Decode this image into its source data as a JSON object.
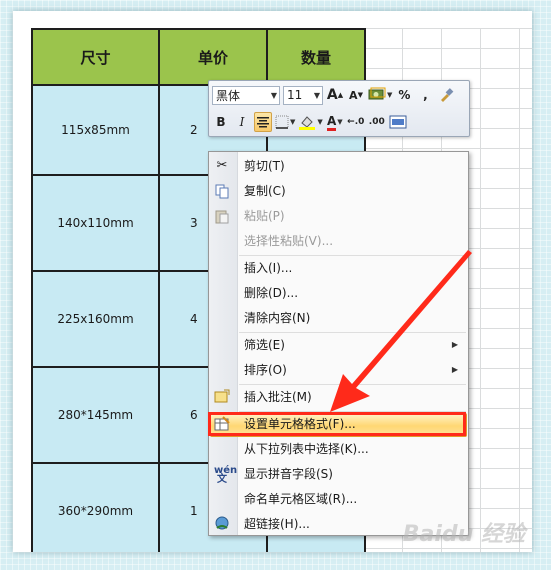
{
  "table": {
    "headers": [
      "尺寸",
      "单价",
      "数量"
    ],
    "rows": [
      {
        "size": "115x85mm",
        "price": "2"
      },
      {
        "size": "140x110mm",
        "price": "3"
      },
      {
        "size": "225x160mm",
        "price": "4"
      },
      {
        "size": "280*145mm",
        "price": "6"
      },
      {
        "size": "360*290mm",
        "price": "1"
      }
    ]
  },
  "minitoolbar": {
    "font_name": "黑体",
    "font_size": "11",
    "grow_font": "A",
    "shrink_font": "A",
    "percent": "%",
    "comma": ",",
    "bold": "B",
    "italic": "I",
    "font_color": "A",
    "inc_decimal": ".0",
    "dec_decimal": ".00"
  },
  "menu": {
    "cut": "剪切(T)",
    "copy": "复制(C)",
    "paste": "粘贴(P)",
    "paste_special": "选择性粘贴(V)...",
    "insert": "插入(I)...",
    "delete": "删除(D)...",
    "clear": "清除内容(N)",
    "filter": "筛选(E)",
    "sort": "排序(O)",
    "insert_comment": "插入批注(M)",
    "format_cells": "设置单元格格式(F)...",
    "pick_from_list": "从下拉列表中选择(K)...",
    "phonetic": "显示拼音字段(S)",
    "name_range": "命名单元格区域(R)...",
    "hyperlink": "超链接(H)..."
  },
  "watermark": "Baidu 经验",
  "colors": {
    "header_green": "#9bc44c",
    "cell_blue": "#c8eaf3",
    "highlight_orange": "#ffd773",
    "annotation_red": "#ff2a1a"
  }
}
